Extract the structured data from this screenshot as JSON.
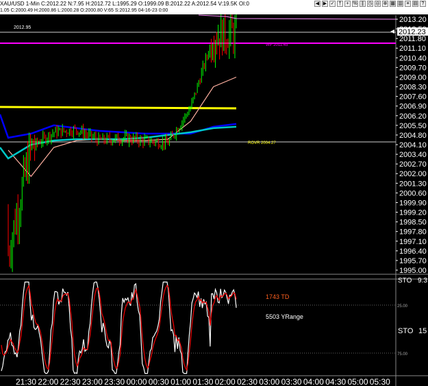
{
  "window": {
    "title": "XAU/USD  1-Min  C:2012.22  N:7.95  H:2012.72  L:1995.29  O:1999.09  B:2012.22  A:2012.54  V:19.5K  OI:0",
    "ohlc": "1.05 C:2000.49 H:2000.86 L:2000.28 O:2000.80 V:65 S:2012.95 04-16-23 0:00"
  },
  "toolbar": {
    "icons": [
      "left-arrow-icon",
      "right-arrow-icon",
      "check-icon",
      "pin-icon",
      "plus-icon",
      "percent-icon",
      "pause-icon",
      "clock-icon",
      "target-icon",
      "zoom-icon",
      "grid-icon",
      "bars-icon",
      "list-icon",
      "chart-icon",
      "help-icon"
    ]
  },
  "colors": {
    "price_up": "#00ff00",
    "price_down": "#ff0000",
    "yellow_line": "#ffff00",
    "blue_ma": "#0000ff",
    "cyan_ma": "#00c8c8",
    "pink_ma": "#ffb0a0",
    "magenta_level": "#ff00ff",
    "stoch_fast": "#ffffff",
    "stoch_slow": "#ff0000"
  },
  "price_panel": {
    "current_price_label": "2012.23",
    "left_level_label": "2012.95",
    "wp_label": "WP 2011.45",
    "rovr_label": "ROVR 2004.27",
    "y_ticks": [
      "2013.20",
      "2012.50",
      "2011.80",
      "2011.10",
      "2010.40",
      "2009.70",
      "2009.00",
      "2008.30",
      "2007.60",
      "2006.90",
      "2006.20",
      "2005.50",
      "2004.80",
      "2004.10",
      "2003.40",
      "2002.70",
      "2002.00",
      "2001.30",
      "2000.60",
      "1999.90",
      "1999.20",
      "1998.50",
      "1997.80",
      "1997.10",
      "1996.40",
      "1995.70",
      "1995.00"
    ]
  },
  "stoch_panel": {
    "td_label": "1743 TD",
    "yrange_label": "5503 YRange",
    "sto_top_label": "STO",
    "sto_top_value": "9.3",
    "sto_mid_label": "STO",
    "sto_mid_value": "15",
    "level_25": "25.00",
    "level_75": "75.00"
  },
  "x_axis": {
    "ticks": [
      "21:30",
      "22:00",
      "22:30",
      "23:00",
      "23:30",
      "00:00",
      "00:30",
      "01:00",
      "01:30",
      "02:00",
      "02:30",
      "03:00",
      "03:30",
      "04:00",
      "04:30",
      "05:00",
      "05:30"
    ]
  },
  "chart_data": {
    "type": "line",
    "price_axis": {
      "min": 1995.0,
      "max": 2013.2
    },
    "stoch_axis": {
      "min": 0,
      "max": 100
    },
    "x": [
      "21:30",
      "22:00",
      "22:30",
      "23:00",
      "23:30",
      "00:00",
      "00:30",
      "01:00",
      "01:30",
      "02:00",
      "02:15"
    ],
    "series": [
      {
        "values": [
          1996.2,
          2003.9,
          2005.0,
          2005.2,
          2004.4,
          2004.6,
          2004.4,
          2004.2,
          2006.8,
          2012.0,
          2012.2
        ]
      },
      {
        "values": [
          2004.6,
          2004.9,
          2005.5,
          2005.3,
          2005.1,
          2005.0,
          2004.9,
          2004.9,
          2004.9,
          2005.4,
          2005.6
        ]
      },
      {
        "values": [
          2003.1,
          2004.1,
          2004.4,
          2004.5,
          2004.5,
          2004.5,
          2004.6,
          2004.8,
          2005.0,
          2005.3,
          2005.4
        ]
      },
      {
        "values": [
          2003.7,
          2001.8,
          2003.9,
          2004.4,
          2004.5,
          2004.4,
          2004.4,
          2004.5,
          2005.8,
          2008.3,
          2009.0
        ]
      }
    ],
    "levels": {
      "yellow": 2006.9,
      "magenta": 2011.9,
      "wp": 2011.45,
      "rovr": 2004.27,
      "left_level": 2012.95
    }
  }
}
